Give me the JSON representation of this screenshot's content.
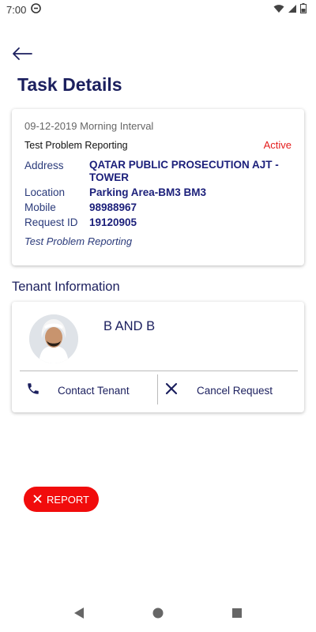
{
  "status_bar": {
    "time": "7:00"
  },
  "header": {
    "title": "Task Details"
  },
  "task": {
    "date_interval": "09-12-2019 Morning Interval",
    "title": "Test Problem Reporting",
    "status": "Active",
    "fields": {
      "address_label": "Address",
      "address_value": "QATAR PUBLIC PROSECUTION AJT - TOWER",
      "location_label": "Location",
      "location_value": "Parking Area-BM3 BM3",
      "mobile_label": "Mobile",
      "mobile_value": "98988967",
      "request_label": "Request ID",
      "request_value": "19120905"
    },
    "note": "Test Problem Reporting"
  },
  "tenant": {
    "section_title": "Tenant Information",
    "name": "B AND B",
    "contact_label": "Contact Tenant",
    "cancel_label": "Cancel Request"
  },
  "report": {
    "label": "REPORT"
  },
  "colors": {
    "accent": "#1b1f5e",
    "danger": "#f10c0c",
    "status_active": "#e41b1b"
  },
  "icons": [
    "signal-icon",
    "wifi-icon",
    "battery-icon",
    "back-arrow-icon",
    "phone-icon",
    "close-icon",
    "nav-back-icon",
    "nav-home-icon",
    "nav-recents-icon"
  ]
}
